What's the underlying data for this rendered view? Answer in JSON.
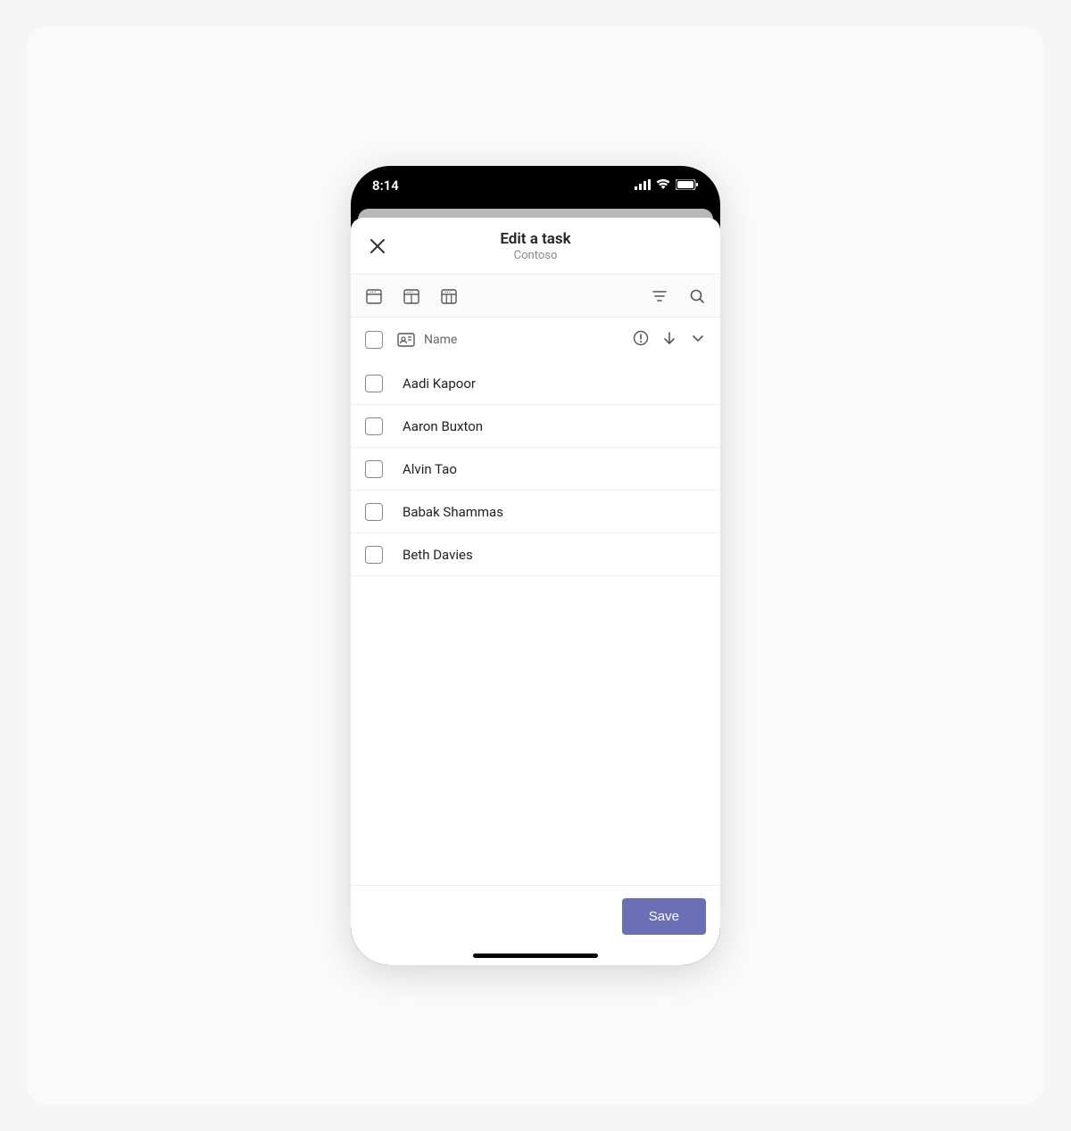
{
  "statusBar": {
    "time": "8:14"
  },
  "header": {
    "title": "Edit a task",
    "subtitle": "Contoso"
  },
  "listHeader": {
    "columnLabel": "Name"
  },
  "people": [
    {
      "name": "Aadi Kapoor"
    },
    {
      "name": "Aaron Buxton"
    },
    {
      "name": "Alvin Tao"
    },
    {
      "name": "Babak Shammas"
    },
    {
      "name": "Beth Davies"
    }
  ],
  "footer": {
    "saveLabel": "Save"
  },
  "colors": {
    "accent": "#6b6fb5"
  }
}
